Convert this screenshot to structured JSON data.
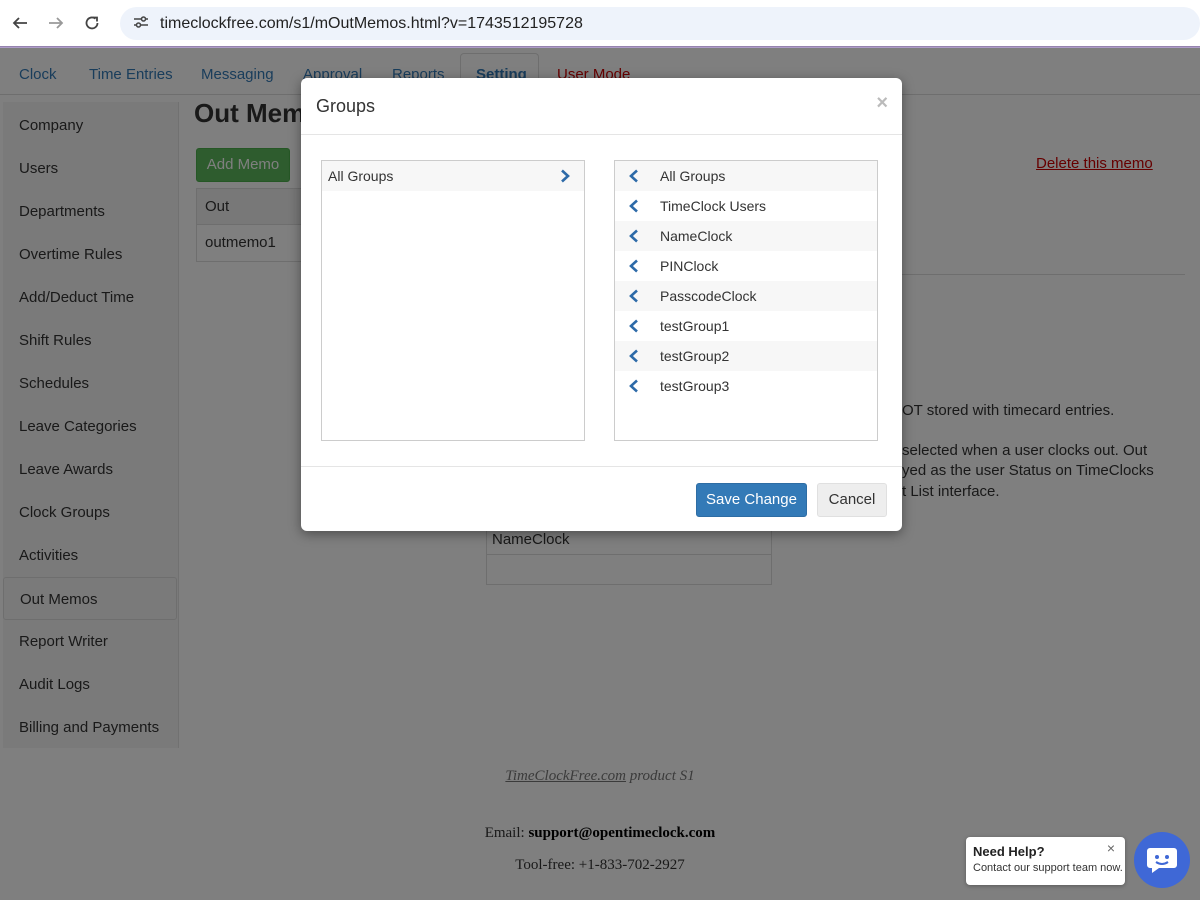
{
  "browser": {
    "url": "timeclockfree.com/s1/mOutMemos.html?v=1743512195728"
  },
  "tabs": [
    {
      "label": "Clock"
    },
    {
      "label": "Time Entries"
    },
    {
      "label": "Messaging"
    },
    {
      "label": "Approval"
    },
    {
      "label": "Reports"
    },
    {
      "label": "Setting"
    },
    {
      "label": "User Mode"
    }
  ],
  "sidebar": {
    "items": [
      {
        "label": "Company"
      },
      {
        "label": "Users"
      },
      {
        "label": "Departments"
      },
      {
        "label": "Overtime Rules"
      },
      {
        "label": "Add/Deduct Time"
      },
      {
        "label": "Shift Rules"
      },
      {
        "label": "Schedules"
      },
      {
        "label": "Leave Categories"
      },
      {
        "label": "Leave Awards"
      },
      {
        "label": "Clock Groups"
      },
      {
        "label": "Activities"
      },
      {
        "label": "Out Memos"
      },
      {
        "label": "Report Writer"
      },
      {
        "label": "Audit Logs"
      },
      {
        "label": "Billing and Payments"
      }
    ]
  },
  "page": {
    "title": "Out Memo",
    "add_memo_label": "Add Memo",
    "table_header": "Out",
    "table_row": "outmemo1",
    "delete_link": "Delete this memo",
    "text_colon": ":",
    "text_line1": "OT stored with timecard entries.",
    "text_line2": "selected when a user clocks out. Out",
    "text_line3": "yed as the user Status on TimeClocks",
    "text_line4": "t List interface.",
    "box_row": "NameClock"
  },
  "footer": {
    "brand_link": "TimeClockFree.com",
    "brand_suffix": " product S1",
    "email_label": "Email: ",
    "email": "support@opentimeclock.com",
    "tel": "Tool-free: +1-833-702-2927"
  },
  "modal": {
    "title": "Groups",
    "close": "×",
    "left_items": [
      {
        "label": "All Groups"
      }
    ],
    "right_items": [
      {
        "label": "All Groups"
      },
      {
        "label": "TimeClock Users"
      },
      {
        "label": "NameClock"
      },
      {
        "label": "PINClock"
      },
      {
        "label": "PasscodeClock"
      },
      {
        "label": "testGroup1"
      },
      {
        "label": "testGroup2"
      },
      {
        "label": "testGroup3"
      }
    ],
    "save_label": "Save Change",
    "cancel_label": "Cancel"
  },
  "help": {
    "title": "Need Help?",
    "subtitle": "Contact our support team now.",
    "close": "×"
  },
  "colors": {
    "link_blue": "#337ab7",
    "save_blue": "#337ab7",
    "add_green": "#5cb85c",
    "danger_red": "#cc0000",
    "help_blue": "#3f68d6"
  }
}
